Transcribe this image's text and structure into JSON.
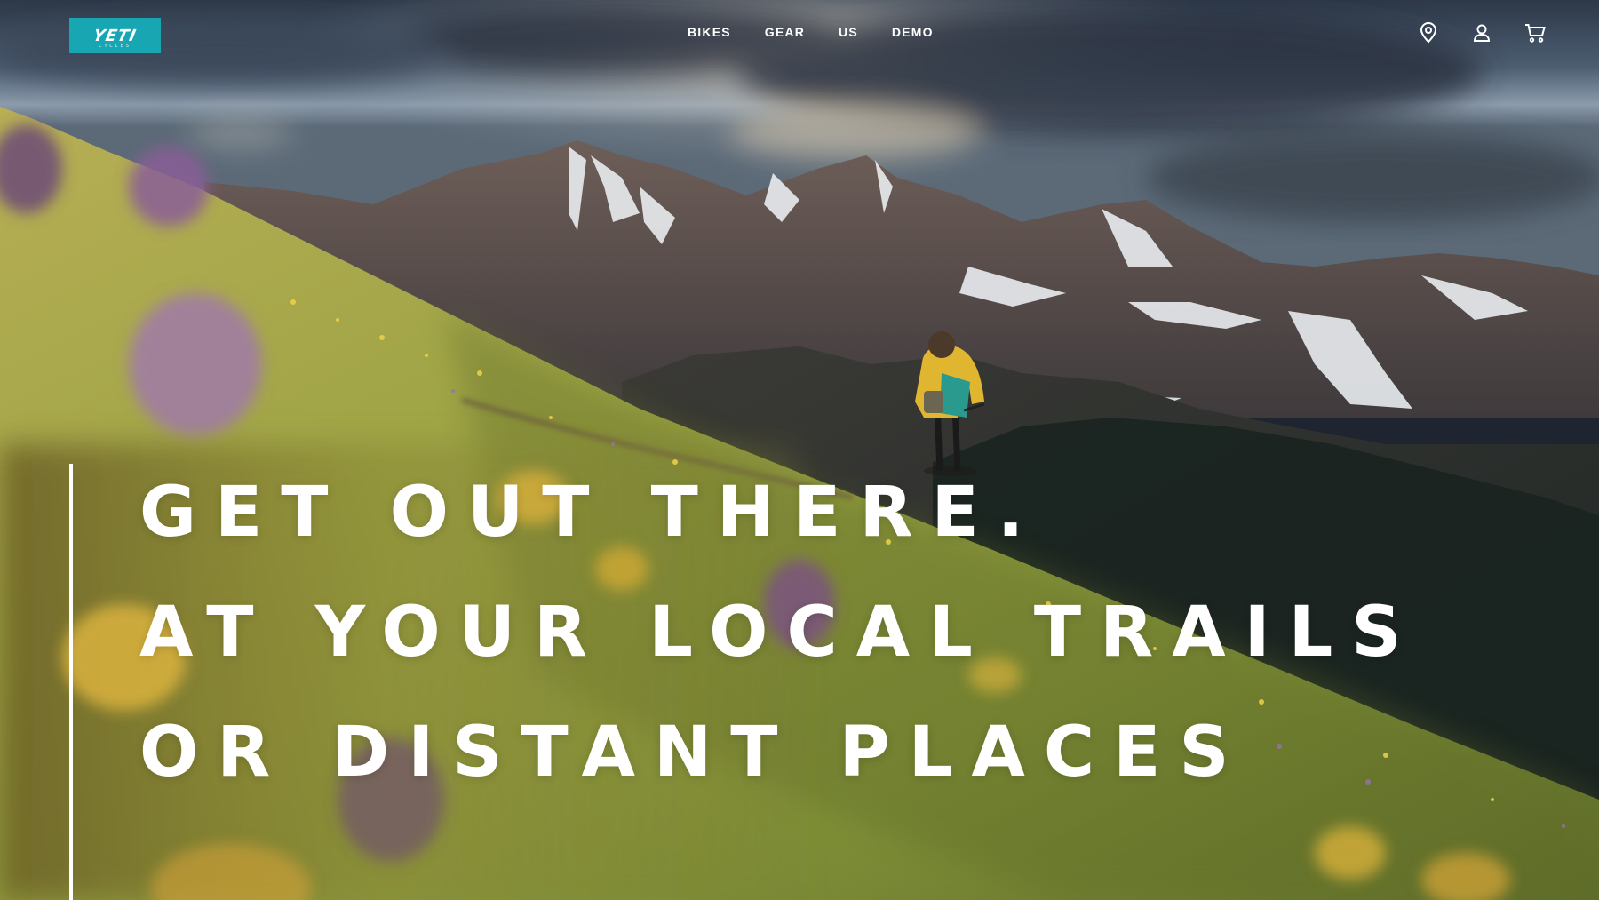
{
  "brand": {
    "logo_text": "YETI",
    "logo_subtext": "CYCLES",
    "accent_color": "#19a6b3"
  },
  "nav": {
    "items": [
      {
        "label": "BIKES"
      },
      {
        "label": "GEAR"
      },
      {
        "label": "US"
      },
      {
        "label": "DEMO"
      }
    ]
  },
  "header_icons": [
    {
      "name": "location-pin-icon"
    },
    {
      "name": "user-account-icon"
    },
    {
      "name": "shopping-cart-icon"
    }
  ],
  "hero": {
    "lines": [
      "GET OUT THERE.",
      "AT YOUR LOCAL TRAILS",
      "OR DISTANT PLACES"
    ],
    "text_color": "#ffffff"
  }
}
